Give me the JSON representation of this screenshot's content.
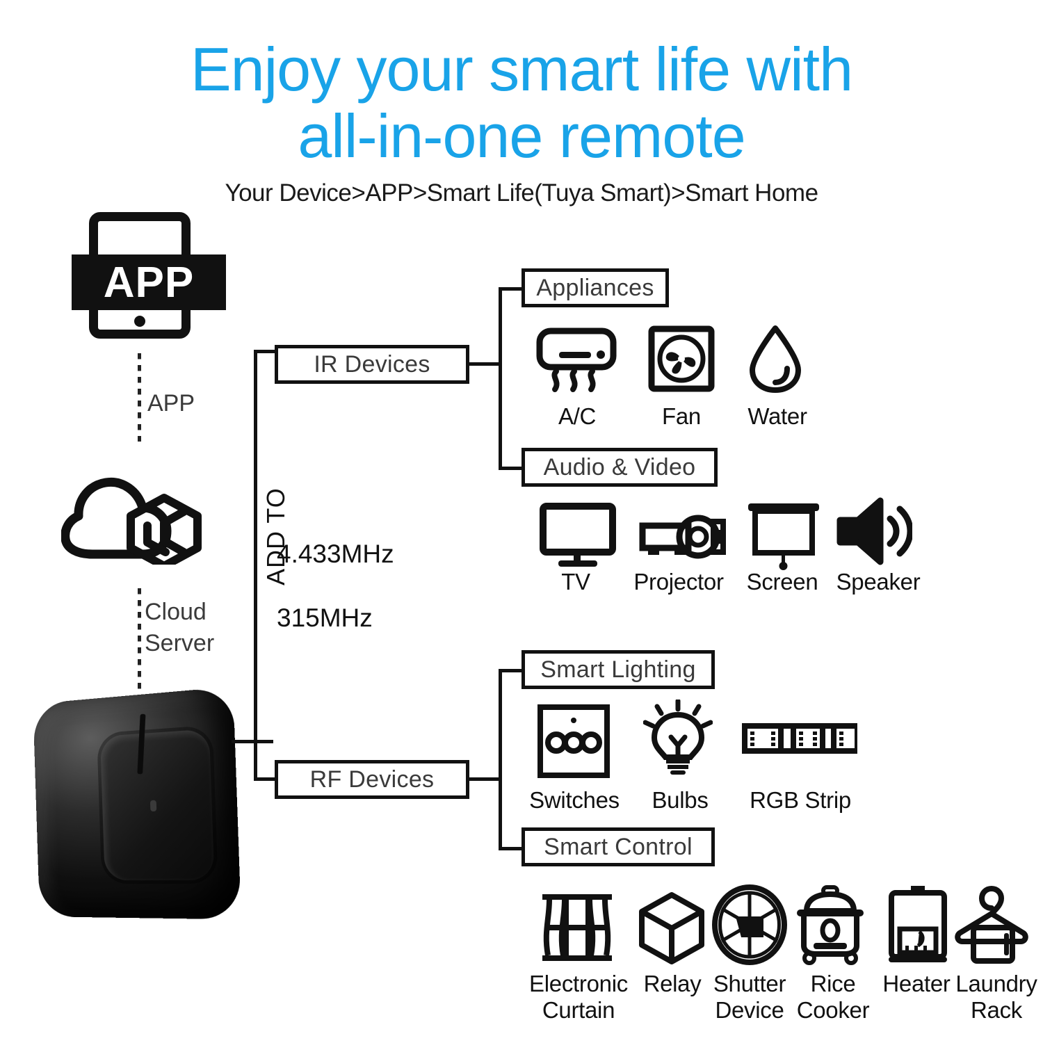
{
  "header": {
    "title": "Enjoy your smart life with\nall-in-one remote",
    "title_color": "#19a3e8",
    "subtitle": "Your Device>APP>Smart Life(Tuya Smart)>Smart Home"
  },
  "left_chain": {
    "app_icon_text": "APP",
    "app_label": "APP",
    "cloud_label": "Cloud\nServer",
    "cloud_label_line1": "Cloud",
    "cloud_label_line2": "Server"
  },
  "trunk": {
    "add_to": "ADD TO",
    "frequencies": "4.433MHz\n315MHz",
    "freq_1": "4.433MHz",
    "freq_2": "315MHz"
  },
  "branches": [
    {
      "id": "ir",
      "label": "IR Devices",
      "groups": [
        {
          "id": "appliances",
          "label": "Appliances",
          "items": [
            {
              "icon": "air-conditioner-icon",
              "label": "A/C"
            },
            {
              "icon": "fan-icon",
              "label": "Fan"
            },
            {
              "icon": "water-drop-icon",
              "label": "Water"
            }
          ]
        },
        {
          "id": "audio-video",
          "label": "Audio & Video",
          "items": [
            {
              "icon": "tv-icon",
              "label": "TV"
            },
            {
              "icon": "projector-icon",
              "label": "Projector"
            },
            {
              "icon": "projection-screen-icon",
              "label": "Screen"
            },
            {
              "icon": "speaker-icon",
              "label": "Speaker"
            }
          ]
        }
      ]
    },
    {
      "id": "rf",
      "label": "RF Devices",
      "groups": [
        {
          "id": "smart-lighting",
          "label": "Smart Lighting",
          "items": [
            {
              "icon": "wall-switch-icon",
              "label": "Switches"
            },
            {
              "icon": "light-bulb-icon",
              "label": "Bulbs"
            },
            {
              "icon": "rgb-led-strip-icon",
              "label": "RGB Strip"
            }
          ]
        },
        {
          "id": "smart-control",
          "label": "Smart Control",
          "items": [
            {
              "icon": "curtain-icon",
              "label": "Electronic\nCurtain",
              "l1": "Electronic",
              "l2": "Curtain"
            },
            {
              "icon": "relay-cube-icon",
              "label": "Relay",
              "l1": "Relay",
              "l2": ""
            },
            {
              "icon": "shutter-aperture-icon",
              "label": "Shutter\nDevice",
              "l1": "Shutter",
              "l2": "Device"
            },
            {
              "icon": "rice-cooker-icon",
              "label": "Rice\nCooker",
              "l1": "Rice",
              "l2": "Cooker"
            },
            {
              "icon": "water-heater-icon",
              "label": "Heater",
              "l1": "Heater",
              "l2": ""
            },
            {
              "icon": "laundry-rack-icon",
              "label": "Laundry\nRack",
              "l1": "Laundry",
              "l2": "Rack"
            }
          ]
        }
      ]
    }
  ],
  "colors": {
    "accent_blue": "#19a3e8",
    "line_black": "#111111",
    "text_gray": "#3a3a3a"
  }
}
